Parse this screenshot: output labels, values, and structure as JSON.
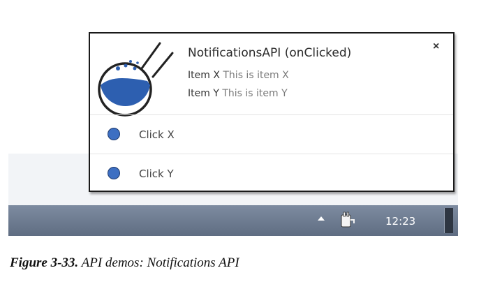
{
  "notification": {
    "title": "NotificationsAPI (onClicked)",
    "close_label": "×",
    "icon": "flask-icon",
    "items": [
      {
        "title": "Item X",
        "message": "This is item X"
      },
      {
        "title": "Item Y",
        "message": "This is item Y"
      }
    ],
    "buttons": [
      {
        "label": "Click X",
        "icon": "blue-dot-icon"
      },
      {
        "label": "Click Y",
        "icon": "blue-dot-icon"
      }
    ]
  },
  "taskbar": {
    "clock": "12:23",
    "icons": [
      "tray-arrow-icon",
      "power-plug-icon",
      "show-desktop-button"
    ]
  },
  "caption": {
    "figure_number": "Figure 3-33.",
    "text": "API demos: Notifications API"
  },
  "colors": {
    "accent": "#3d6fc2",
    "taskbar": "#6b798e",
    "border": "#1a1a1a"
  }
}
